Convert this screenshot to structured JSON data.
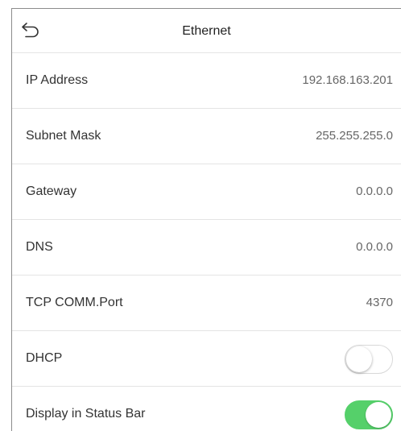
{
  "header": {
    "title": "Ethernet",
    "back_icon": "back-arrow-icon"
  },
  "settings": [
    {
      "label": "IP Address",
      "value": "192.168.163.201"
    },
    {
      "label": "Subnet Mask",
      "value": "255.255.255.0"
    },
    {
      "label": "Gateway",
      "value": "0.0.0.0"
    },
    {
      "label": "DNS",
      "value": "0.0.0.0"
    },
    {
      "label": "TCP COMM.Port",
      "value": "4370"
    }
  ],
  "toggles": [
    {
      "label": "DHCP",
      "enabled": false
    },
    {
      "label": "Display in Status Bar",
      "enabled": true
    }
  ],
  "colors": {
    "toggle_on": "#55d06a",
    "divider": "#e4e4e4"
  }
}
